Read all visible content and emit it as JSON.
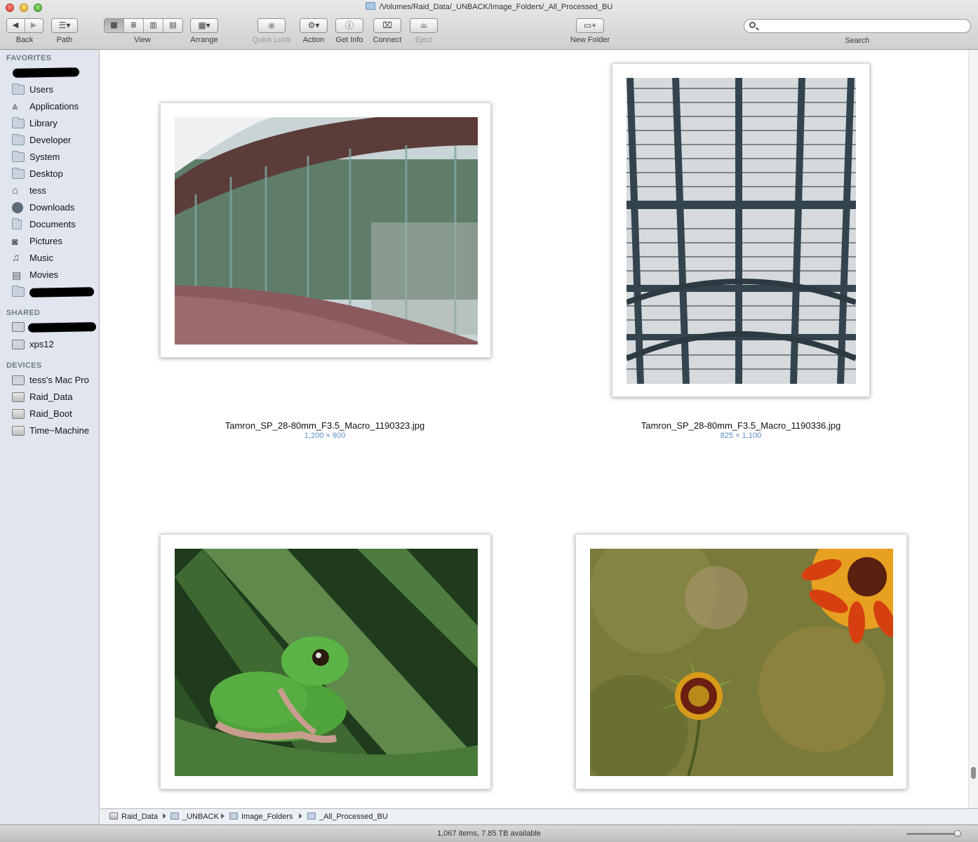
{
  "window": {
    "title": "/Volumes/Raid_Data/_UNBACK/Image_Folders/_All_Processed_BU"
  },
  "toolbar": {
    "back": "Back",
    "path": "Path",
    "view": "View",
    "arrange": "Arrange",
    "quick_look": "Quick Look",
    "action": "Action",
    "get_info": "Get Info",
    "connect": "Connect",
    "eject": "Eject",
    "new_folder": "New Folder",
    "search": "Search",
    "search_value": ""
  },
  "sidebar": {
    "favorites_header": "FAVORITES",
    "favorites": [
      "Users",
      "Applications",
      "Library",
      "Developer",
      "System",
      "Desktop",
      "tess",
      "Downloads",
      "Documents",
      "Pictures",
      "Music",
      "Movies"
    ],
    "shared_header": "SHARED",
    "shared": [
      "xps12"
    ],
    "devices_header": "DEVICES",
    "devices": [
      "tess's Mac Pro",
      "Raid_Data",
      "Raid_Boot",
      "Time~Machine"
    ]
  },
  "files": [
    {
      "name": "Tamron_SP_28-80mm_F3.5_Macro_1190323.jpg",
      "dims": "1,200 × 900"
    },
    {
      "name": "Tamron_SP_28-80mm_F3.5_Macro_1190336.jpg",
      "dims": "825 × 1,100"
    }
  ],
  "pathbar": [
    "Raid_Data",
    "_UNBACK",
    "Image_Folders",
    "_All_Processed_BU"
  ],
  "status": "1,067 items, 7.85 TB available",
  "colors": {
    "sidebar_bg": "#e1e6ee",
    "dims_text": "#5b8bc5"
  }
}
